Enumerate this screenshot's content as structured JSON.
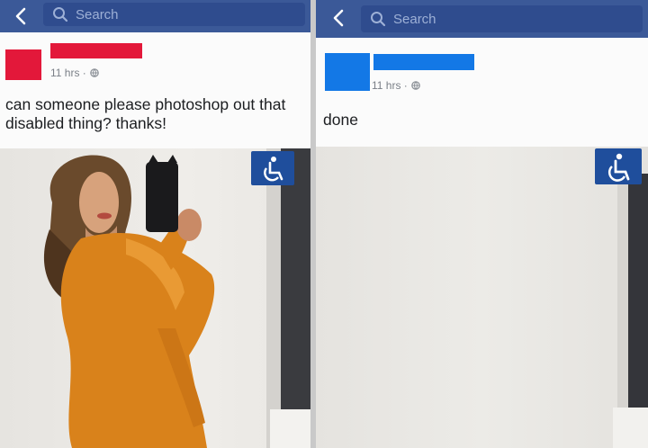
{
  "left_post": {
    "search_placeholder": "Search",
    "timestamp": "11 hrs ·",
    "text": "can someone please photoshop out that disabled thing? thanks!"
  },
  "right_post": {
    "search_placeholder": "Search",
    "timestamp": "11 hrs ·",
    "text": "done"
  },
  "colors": {
    "facebook_blue": "#3b5998",
    "left_censor_red": "#e3183a",
    "right_censor_blue": "#1378e6",
    "accessibility_sign": "#1f4e9c",
    "dress_orange": "#d9821b"
  },
  "icons": {
    "back": "chevron-left",
    "search": "magnifier",
    "privacy": "globe",
    "sign": "wheelchair-accessibility"
  }
}
